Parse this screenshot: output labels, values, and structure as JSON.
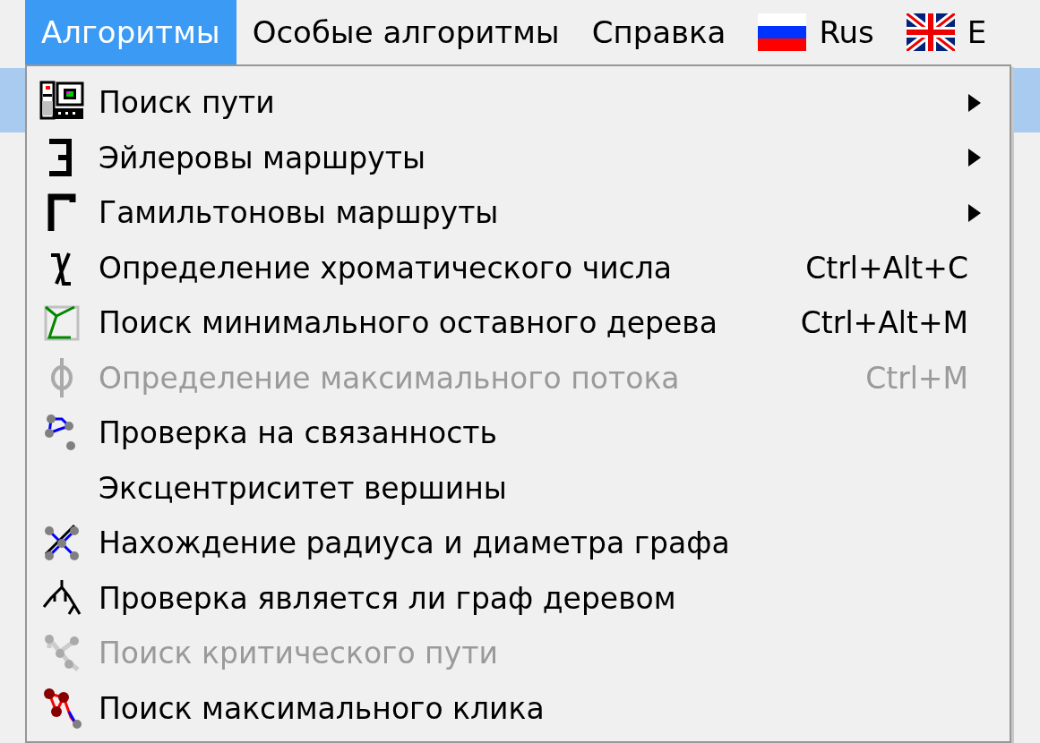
{
  "menubar": [
    {
      "label": "Алгоритмы",
      "selected": true
    },
    {
      "label": "Особые алгоритмы",
      "selected": false
    },
    {
      "label": "Справка",
      "selected": false
    },
    {
      "label": "Rus",
      "selected": false
    },
    {
      "label": "E",
      "selected": false
    }
  ],
  "menu": {
    "items": [
      {
        "label": "Поиск пути",
        "disabled": false,
        "submenu": true
      },
      {
        "label": "Эйлеровы маршруты",
        "disabled": false,
        "submenu": true
      },
      {
        "label": "Гамильтоновы маршруты",
        "disabled": false,
        "submenu": true
      },
      {
        "label": "Определение хроматического числа",
        "shortcut": "Ctrl+Alt+C",
        "disabled": false,
        "submenu": false
      },
      {
        "label": "Поиск минимального оставного дерева",
        "shortcut": "Ctrl+Alt+M",
        "disabled": false,
        "submenu": false
      },
      {
        "label": "Определение максимального потока",
        "shortcut": "Ctrl+M",
        "disabled": true,
        "submenu": false
      },
      {
        "label": "Проверка на связанность",
        "disabled": false,
        "submenu": false
      },
      {
        "label": "Эксцентриситет вершины",
        "disabled": false,
        "submenu": false
      },
      {
        "label": "Нахождение радиуса и диаметра графа",
        "disabled": false,
        "submenu": false
      },
      {
        "label": "Проверка является ли граф деревом",
        "disabled": false,
        "submenu": false
      },
      {
        "label": "Поиск критического пути",
        "disabled": true,
        "submenu": false
      },
      {
        "label": "Поиск максимального клика",
        "disabled": false,
        "submenu": false
      }
    ]
  }
}
